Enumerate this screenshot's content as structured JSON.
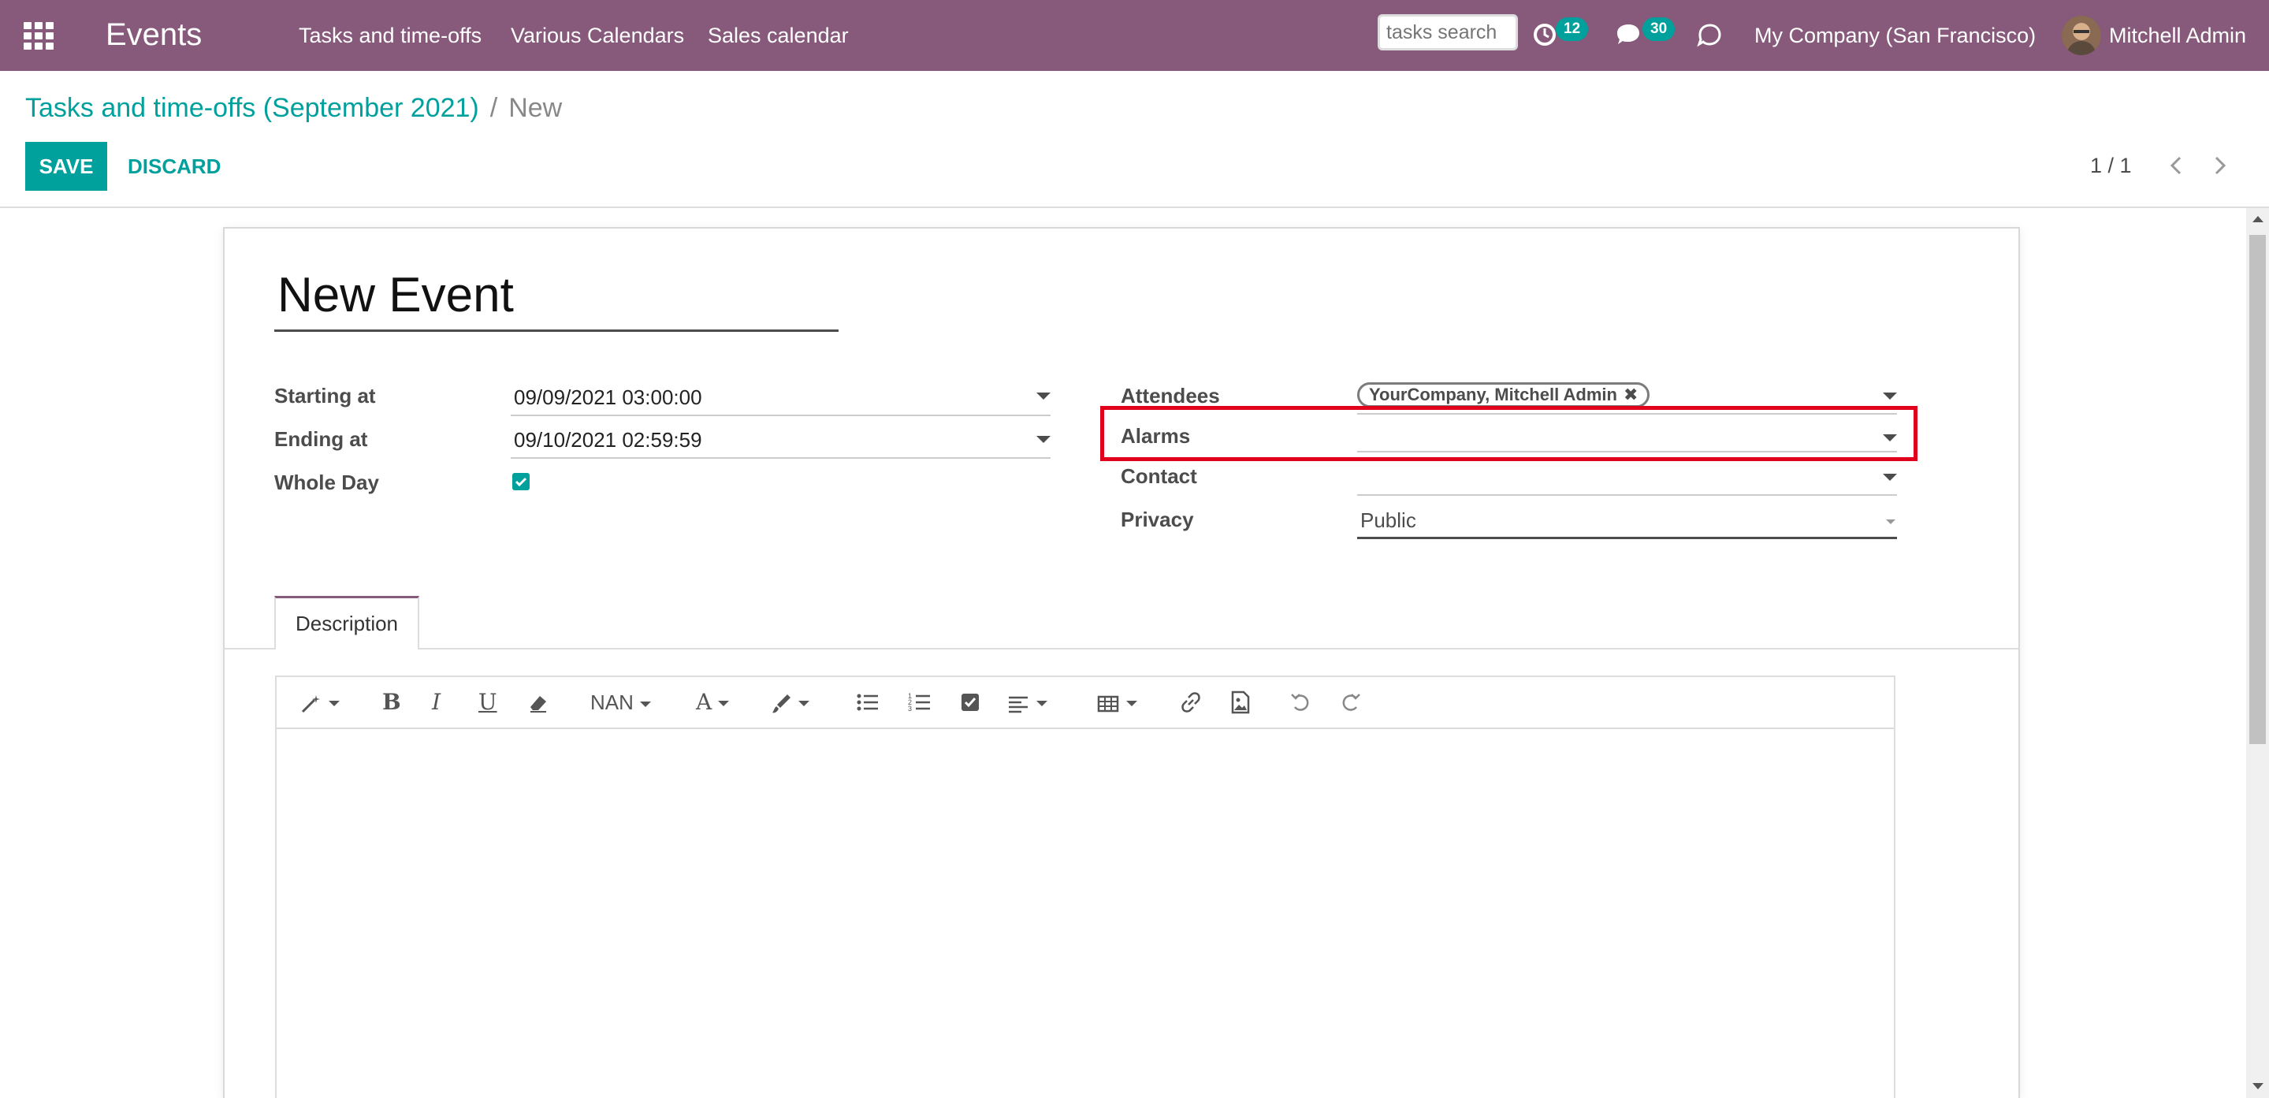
{
  "navbar": {
    "brand": "Events",
    "menu": [
      "Tasks and time-offs",
      "Various Calendars",
      "Sales calendar"
    ],
    "search_placeholder": "tasks search",
    "activity_count": "12",
    "messages_count": "30",
    "company": "My Company (San Francisco)",
    "user": "Mitchell Admin",
    "color": "#875a7b"
  },
  "control_panel": {
    "breadcrumb_parent": "Tasks and time-offs (September 2021)",
    "breadcrumb_separator": "/",
    "breadcrumb_current": "New",
    "save_label": "SAVE",
    "discard_label": "DISCARD",
    "pager": "1 / 1"
  },
  "form": {
    "title": "New Event",
    "labels": {
      "start": "Starting at",
      "stop": "Ending at",
      "allday": "Whole Day",
      "attendees": "Attendees",
      "alarms": "Alarms",
      "contact": "Contact",
      "privacy": "Privacy"
    },
    "values": {
      "start": "09/09/2021 03:00:00",
      "stop": "09/10/2021 02:59:59",
      "allday": true,
      "attendee_tag": "YourCompany, Mitchell Admin",
      "alarms": "",
      "contact": "",
      "privacy": "Public"
    },
    "tabs": [
      "Description"
    ],
    "toolbar": {
      "font_size": "NAN",
      "font_color_label": "A"
    }
  },
  "accent_color": "#00a09d",
  "highlight_color": "#e0001b"
}
